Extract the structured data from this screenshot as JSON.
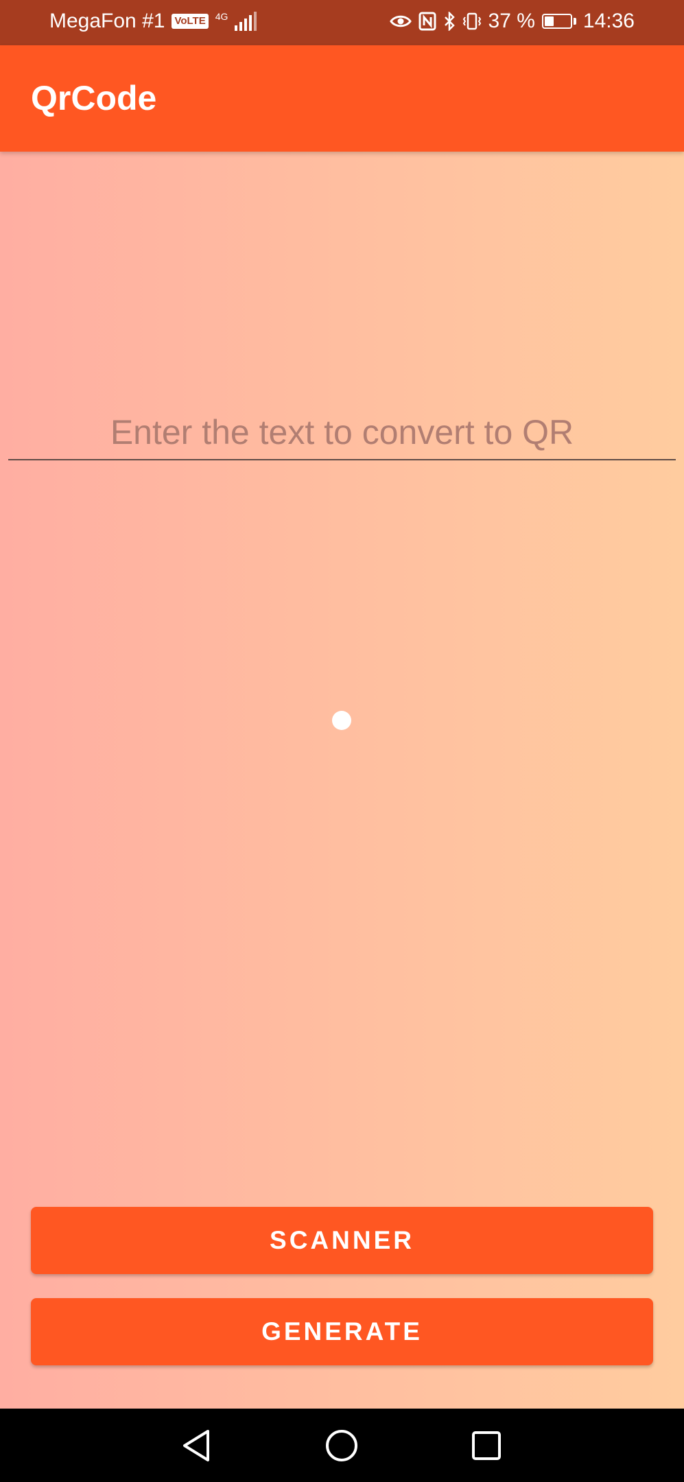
{
  "status_bar": {
    "carrier": "MegaFon #1",
    "volte": "VoLTE",
    "network": "4G",
    "battery_percent": "37 %",
    "battery_level": 0.37,
    "time": "14:36",
    "icons": [
      "eye-icon",
      "nfc-icon",
      "bluetooth-icon",
      "vibrate-icon",
      "battery-icon",
      "signal-icon"
    ]
  },
  "app_bar": {
    "title": "QrCode"
  },
  "input": {
    "placeholder": "Enter the text to convert to QR",
    "value": ""
  },
  "buttons": {
    "scanner": "SCANNER",
    "generate": "GENERATE"
  },
  "nav_bar": {
    "icons": [
      "back-icon",
      "home-icon",
      "recents-icon"
    ]
  },
  "colors": {
    "status_bar": "#a63c1f",
    "accent": "#ff5722",
    "gradient_start": "#ffaea2",
    "gradient_end": "#ffcc9f"
  }
}
